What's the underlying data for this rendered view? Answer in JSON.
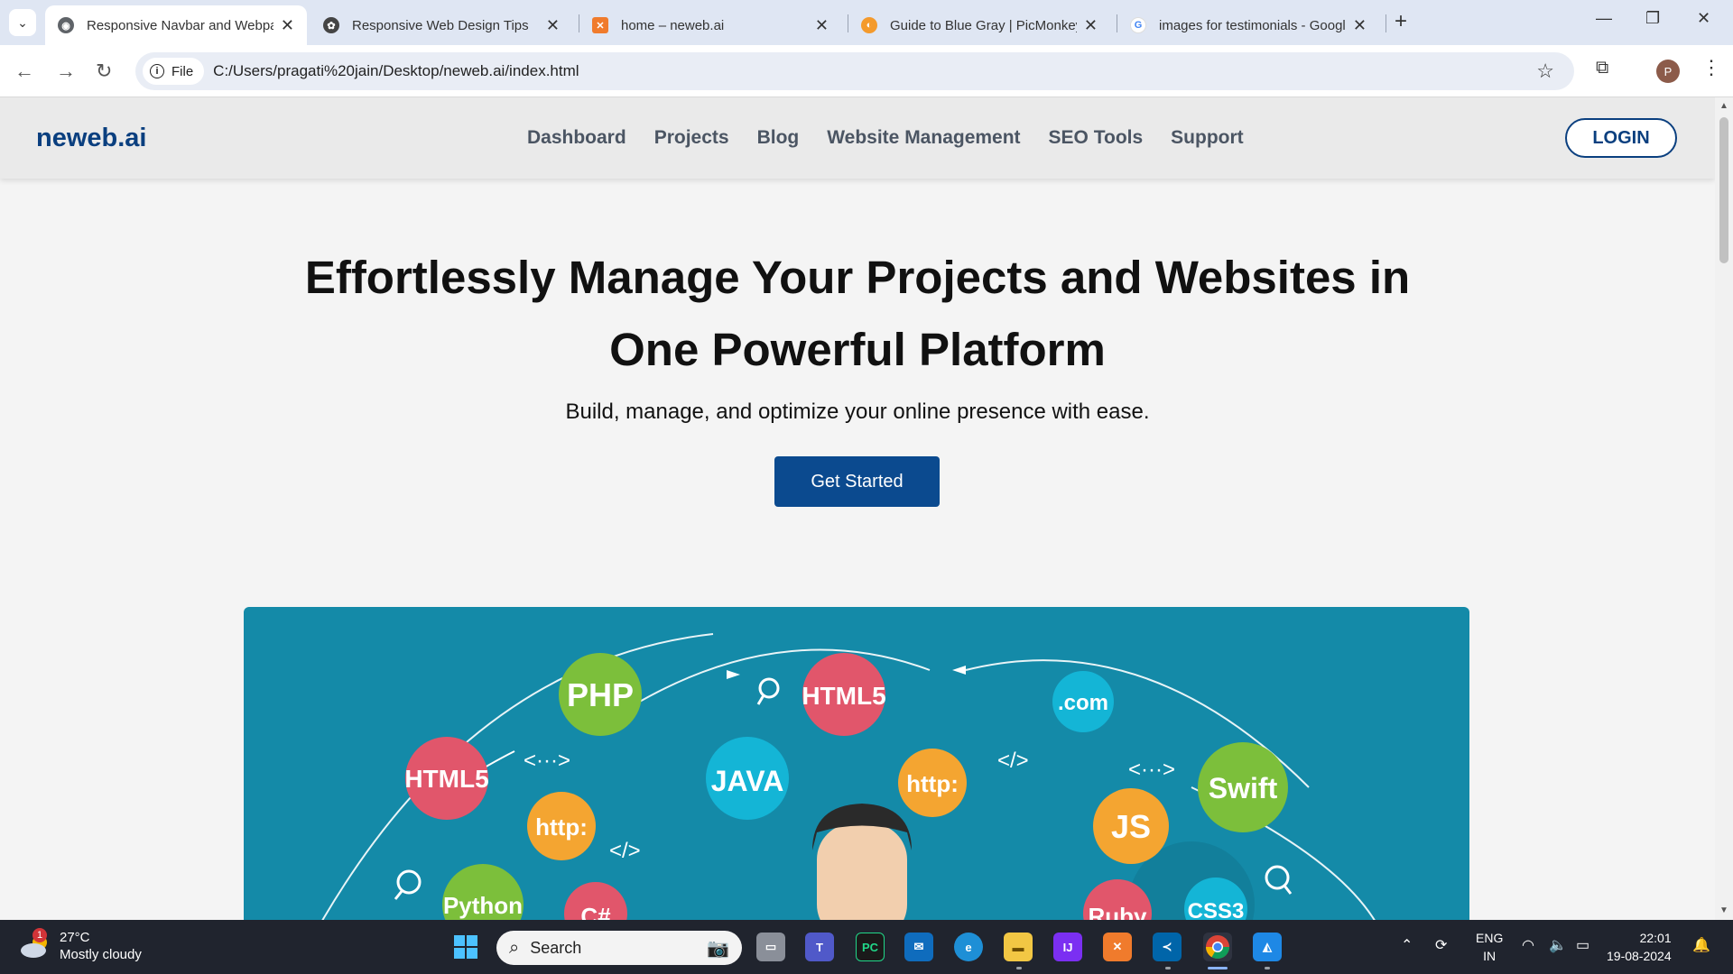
{
  "browser": {
    "tabs": [
      {
        "title": "Responsive Navbar and Webpa",
        "active": true
      },
      {
        "title": "Responsive Web Design Tips"
      },
      {
        "title": "home – neweb.ai"
      },
      {
        "title": "Guide to Blue Gray | PicMonkey"
      },
      {
        "title": "images for testimonials - Googl"
      }
    ],
    "url_scheme": "File",
    "url": "C:/Users/pragati%20jain/Desktop/neweb.ai/index.html",
    "profile_initial": "P"
  },
  "site": {
    "brand": "neweb.ai",
    "nav": [
      "Dashboard",
      "Projects",
      "Blog",
      "Website Management",
      "SEO Tools",
      "Support"
    ],
    "login_label": "LOGIN",
    "hero_title_line1": "Effortlessly Manage Your Projects and Websites in",
    "hero_title_line2": "One Powerful Platform",
    "hero_subtitle": "Build, manage, and optimize your online presence with ease.",
    "cta_label": "Get Started",
    "illustration_labels": [
      "PHP",
      "HTML5",
      ".com",
      "HTML5",
      "JAVA",
      "http:",
      "Swift",
      "http:",
      "JS",
      "Python",
      "C#",
      "Ruby",
      "CSS3"
    ],
    "colors": {
      "brand": "#0a3f7f",
      "cta": "#0b4a8f",
      "hero_bg": "#148aa8"
    }
  },
  "taskbar": {
    "temperature": "27°C",
    "weather": "Mostly cloudy",
    "weather_badge": "1",
    "search_placeholder": "Search",
    "lang_line1": "ENG",
    "lang_line2": "IN",
    "time": "22:01",
    "date": "19-08-2024"
  }
}
